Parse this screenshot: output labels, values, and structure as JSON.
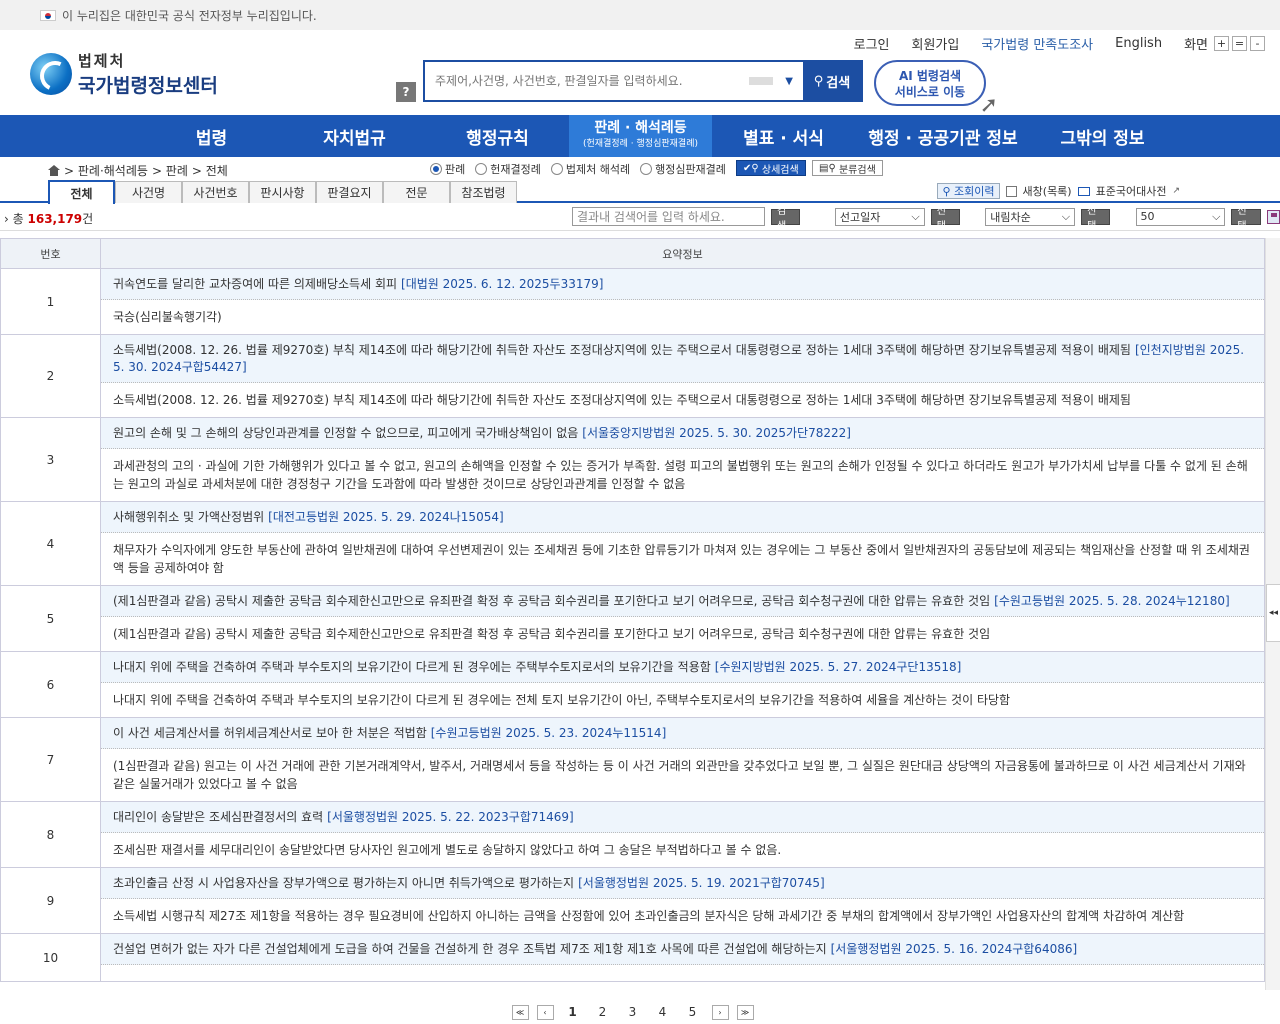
{
  "gov_banner": {
    "text": "이 누리집은 대한민국 공식 전자정부 누리집입니다."
  },
  "header": {
    "logo_top": "법제처",
    "logo_bottom": "국가법령정보센터",
    "util_links": [
      "로그인",
      "회원가입",
      "국가법령 만족도조사",
      "English",
      "화면"
    ],
    "zoom": [
      "+",
      "=",
      "-"
    ],
    "help": "?",
    "search_placeholder": "주제어,사건명, 사건번호, 판결일자를 입력하세요.",
    "search_button": "검색",
    "ai_badge_line1": "AI 법령검색",
    "ai_badge_line2": "서비스로 이동"
  },
  "gnb": {
    "items": [
      "법령",
      "자치법규",
      "행정규칙",
      "판례 · 해석례등",
      "별표 · 서식",
      "행정 · 공공기관 정보",
      "그밖의 정보"
    ],
    "active_sub": "(헌재결정례 · 행정심판재결례)"
  },
  "breadcrumb": [
    "> 판례·해석례등",
    "> 판례",
    "> 전체"
  ],
  "radios": [
    {
      "label": "판례",
      "checked": true
    },
    {
      "label": "헌재결정례",
      "checked": false
    },
    {
      "label": "법제처 해석례",
      "checked": false
    },
    {
      "label": "행정심판재결례",
      "checked": false
    }
  ],
  "detail_search": "상세검색",
  "class_search": "분류검색",
  "tabs": [
    "전체",
    "사건명",
    "사건번호",
    "판시사항",
    "판결요지",
    "전문",
    "참조법령"
  ],
  "tabs_right": {
    "history": "조회이력",
    "new_window": "새창(목록)",
    "dictionary": "표준국어대사전"
  },
  "result_bar": {
    "prefix": "총",
    "count": "163,179",
    "suffix": "건",
    "input_placeholder": "결과내 검색어를 입력 하세요.",
    "search_btn": "검색",
    "sort_field": "선고일자",
    "select_btn": "선택",
    "sort_order": "내림차순",
    "page_size": "50"
  },
  "table": {
    "headers": [
      "번호",
      "요약정보"
    ],
    "rows": [
      {
        "num": "1",
        "title": "귀속연도를 달리한 교차증여에 따른 의제배당소득세 회피",
        "ref": "[대법원 2025. 6. 12. 2025두33179]",
        "summary": "국승(심리불속행기각)"
      },
      {
        "num": "2",
        "title": "소득세법(2008. 12. 26. 법률 제9270호) 부칙 제14조에 따라 해당기간에 취득한 자산도 조정대상지역에 있는 주택으로서 대통령령으로 정하는 1세대 3주택에 해당하면 장기보유특별공제 적용이 배제됨",
        "ref": "[인천지방법원 2025. 5. 30. 2024구합54427]",
        "summary": "소득세법(2008. 12. 26. 법률 제9270호) 부칙 제14조에 따라 해당기간에 취득한 자산도 조정대상지역에 있는 주택으로서 대통령령으로 정하는 1세대 3주택에 해당하면 장기보유특별공제 적용이 배제됨"
      },
      {
        "num": "3",
        "title": "원고의 손해 및 그 손해의 상당인과관계를 인정할 수 없으므로, 피고에게 국가배상책임이 없음",
        "ref": "[서울중앙지방법원 2025. 5. 30. 2025가단78222]",
        "summary": "과세관청의 고의 · 과실에 기한 가해행위가 있다고 볼 수 없고, 원고의 손해액을 인정할 수 있는 증거가 부족함. 설령 피고의 불법행위 또는 원고의 손해가 인정될 수 있다고 하더라도 원고가 부가가치세 납부를 다툴 수 없게 된 손해는 원고의 과실로 과세처분에 대한 경정청구 기간을 도과함에 따라 발생한 것이므로 상당인과관계를 인정할 수 없음"
      },
      {
        "num": "4",
        "title": "사해행위취소 및 가액산정범위",
        "ref": "[대전고등법원 2025. 5. 29. 2024나15054]",
        "summary": "채무자가 수익자에게 양도한 부동산에 관하여 일반채권에 대하여 우선변제권이 있는 조세채권 등에 기초한 압류등기가 마쳐져 있는 경우에는 그 부동산 중에서 일반채권자의 공동담보에 제공되는 책임재산을 산정할 때 위 조세채권액 등을 공제하여야 함"
      },
      {
        "num": "5",
        "title": "(제1심판결과 같음) 공탁시 제출한 공탁금 회수제한신고만으로 유죄판결 확정 후 공탁금 회수권리를 포기한다고 보기 어려우므로, 공탁금 회수청구권에 대한 압류는 유효한 것임",
        "ref": "[수원고등법원 2025. 5. 28. 2024누12180]",
        "summary": "(제1심판결과 같음) 공탁시 제출한 공탁금 회수제한신고만으로 유죄판결 확정 후 공탁금 회수권리를 포기한다고 보기 어려우므로, 공탁금 회수청구권에 대한 압류는 유효한 것임"
      },
      {
        "num": "6",
        "title": "나대지 위에 주택을 건축하여 주택과 부수토지의 보유기간이 다르게 된 경우에는 주택부수토지로서의 보유기간을 적용함",
        "ref": "[수원지방법원 2025. 5. 27. 2024구단13518]",
        "summary": "나대지 위에 주택을 건축하여 주택과 부수토지의 보유기간이 다르게 된 경우에는 전체 토지 보유기간이 아닌, 주택부수토지로서의 보유기간을 적용하여 세율을 계산하는 것이 타당함"
      },
      {
        "num": "7",
        "title": "이 사건 세금계산서를 허위세금계산서로 보아 한 처분은 적법함",
        "ref": "[수원고등법원 2025. 5. 23. 2024누11514]",
        "summary": "(1심판결과 같음) 원고는 이 사건 거래에 관한 기본거래계약서, 발주서, 거래명세서 등을 작성하는 등 이 사건 거래의 외관만을 갖추었다고 보일 뿐, 그 실질은 원단대금 상당액의 자금융통에 불과하므로 이 사건 세금계산서 기재와 같은 실물거래가 있었다고 볼 수 없음"
      },
      {
        "num": "8",
        "title": "대리인이 송달받은 조세심판결정서의 효력",
        "ref": "[서울행정법원 2025. 5. 22. 2023구합71469]",
        "summary": "조세심판 재결서를 세무대리인이 송달받았다면 당사자인 원고에게 별도로 송달하지 않았다고 하여 그 송달은 부적법하다고 볼 수 없음."
      },
      {
        "num": "9",
        "title": "초과인출금 산정 시 사업용자산을 장부가액으로 평가하는지 아니면 취득가액으로 평가하는지",
        "ref": "[서울행정법원 2025. 5. 19. 2021구합70745]",
        "summary": "소득세법 시행규칙 제27조 제1항을 적용하는 경우 필요경비에 산입하지 아니하는 금액을 산정함에 있어 초과인출금의 분자식은 당해 과세기간 중 부채의 합계액에서 장부가액인 사업용자산의 합계액 차감하여 계산함"
      },
      {
        "num": "10",
        "title": "건설업 면허가 없는 자가 다른 건설업체에게 도급을 하여 건물을 건설하게 한 경우 조특법 제7조 제1항 제1호 사목에 따른 건설업에 해당하는지",
        "ref": "[서울행정법원 2025. 5. 16. 2024구합64086]",
        "summary": ""
      }
    ]
  },
  "pager": {
    "first": "≪",
    "prev": "‹",
    "pages": [
      "1",
      "2",
      "3",
      "4",
      "5"
    ],
    "current": "1",
    "next": "›",
    "last": "≫"
  },
  "side_handle": "◂◂"
}
